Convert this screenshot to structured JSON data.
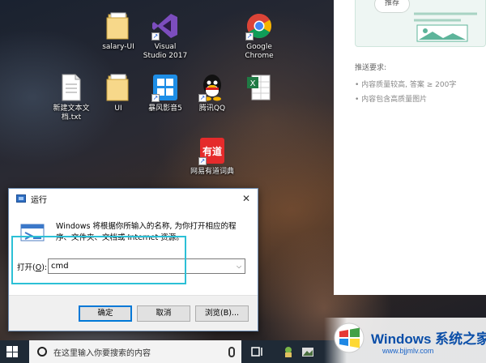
{
  "desktop_icons": [
    {
      "id": "salary",
      "label": "salary-UI",
      "icon": "folder-icon"
    },
    {
      "id": "vs",
      "label": "Visual\nStudio 2017",
      "icon": "visual-studio-icon"
    },
    {
      "id": "chrome",
      "label": "Google\nChrome",
      "icon": "chrome-icon"
    },
    {
      "id": "txt",
      "label": "新建文本文\n档.txt",
      "icon": "text-file-icon"
    },
    {
      "id": "ui",
      "label": "UI",
      "icon": "folder-icon"
    },
    {
      "id": "storm",
      "label": "暴风影音5",
      "icon": "baofeng-icon"
    },
    {
      "id": "qq",
      "label": "腾讯QQ",
      "icon": "qq-icon"
    },
    {
      "id": "excel",
      "label": "",
      "icon": "excel-icon"
    },
    {
      "id": "youdao",
      "label": "网易有道词典",
      "icon": "youdao-icon"
    }
  ],
  "side_panel": {
    "pill_text": "推荐",
    "heading": "推送要求:",
    "bullets": [
      "• 内容质量较高, 答案 ≥ 200字",
      "• 内容包含高质量图片"
    ]
  },
  "run_dialog": {
    "title": "运行",
    "description": "Windows 将根据你所输入的名称, 为你打开相应的程序、文件夹、文档或 Internet 资源。",
    "open_label": "打开(",
    "open_mnemonic": "O",
    "open_label_end": "):",
    "open_value": "cmd",
    "buttons": {
      "ok": "确定",
      "cancel": "取消",
      "browse": "浏览(B)..."
    }
  },
  "taskbar": {
    "search_placeholder": "在这里输入你要搜索的内容"
  },
  "watermark": {
    "brand": "Windows 系统之家",
    "url": "www.bjjmlv.com"
  },
  "colors": {
    "highlight": "#2cc0d6",
    "primary_button_border": "#0078d7",
    "watermark_blue": "#0a4ea8"
  }
}
